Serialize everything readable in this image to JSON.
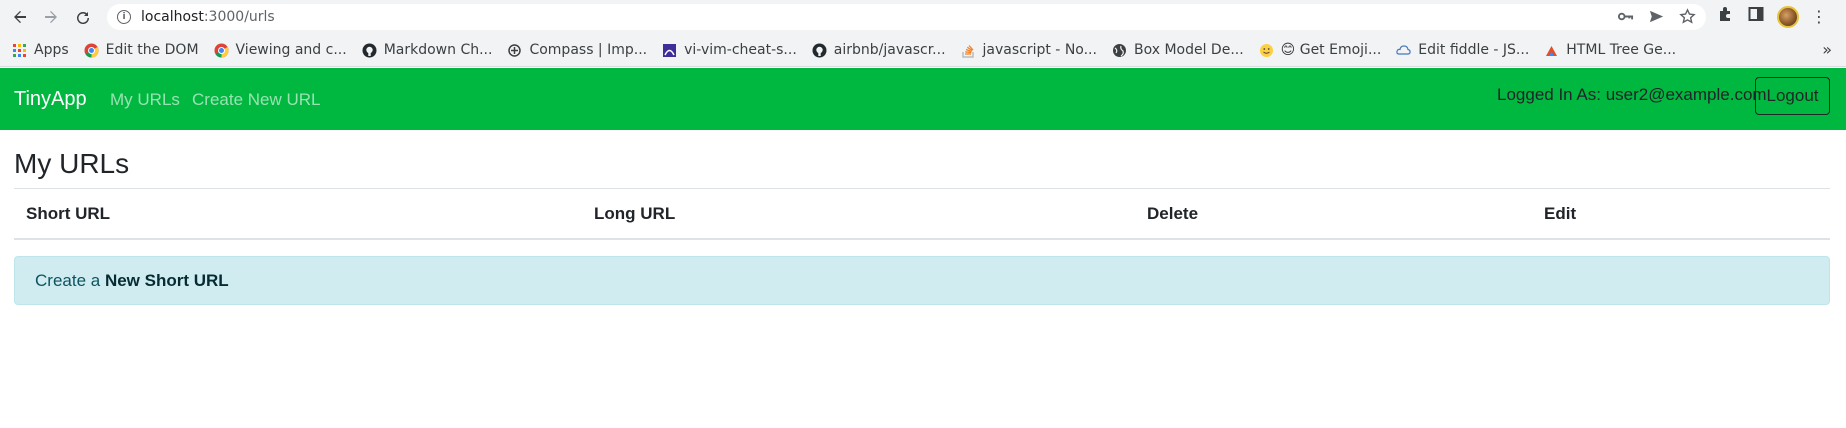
{
  "browser": {
    "url_host": "localhost",
    "url_path": ":3000/urls",
    "bookmarks": [
      {
        "label": "Apps",
        "icon": "apps-grid-icon"
      },
      {
        "label": "Edit the DOM",
        "icon": "chrome-icon"
      },
      {
        "label": "Viewing and c...",
        "icon": "chrome-icon"
      },
      {
        "label": "Markdown Ch...",
        "icon": "github-icon"
      },
      {
        "label": "Compass | Imp...",
        "icon": "compass-icon"
      },
      {
        "label": "vi-vim-cheat-s...",
        "icon": "vim-icon"
      },
      {
        "label": "airbnb/javascr...",
        "icon": "github-icon"
      },
      {
        "label": "javascript - No...",
        "icon": "stackoverflow-icon"
      },
      {
        "label": "Box Model De...",
        "icon": "globe-icon"
      },
      {
        "label": "😊 Get Emoji...",
        "icon": "emoji-icon"
      },
      {
        "label": "Edit fiddle - JS...",
        "icon": "jsfiddle-icon"
      },
      {
        "label": "HTML Tree Ge...",
        "icon": "tree-icon"
      }
    ],
    "more_label": "»"
  },
  "navbar": {
    "brand": "TinyApp",
    "links": [
      "My URLs",
      "Create New URL"
    ],
    "logged_in_text": "Logged In As: user2@example.com",
    "logout_label": "Logout",
    "brand_color": "#00b73f"
  },
  "main": {
    "title": "My URLs",
    "columns": [
      "Short URL",
      "Long URL",
      "Delete",
      "Edit"
    ],
    "alert_prefix": "Create a ",
    "alert_link": "New Short URL"
  }
}
